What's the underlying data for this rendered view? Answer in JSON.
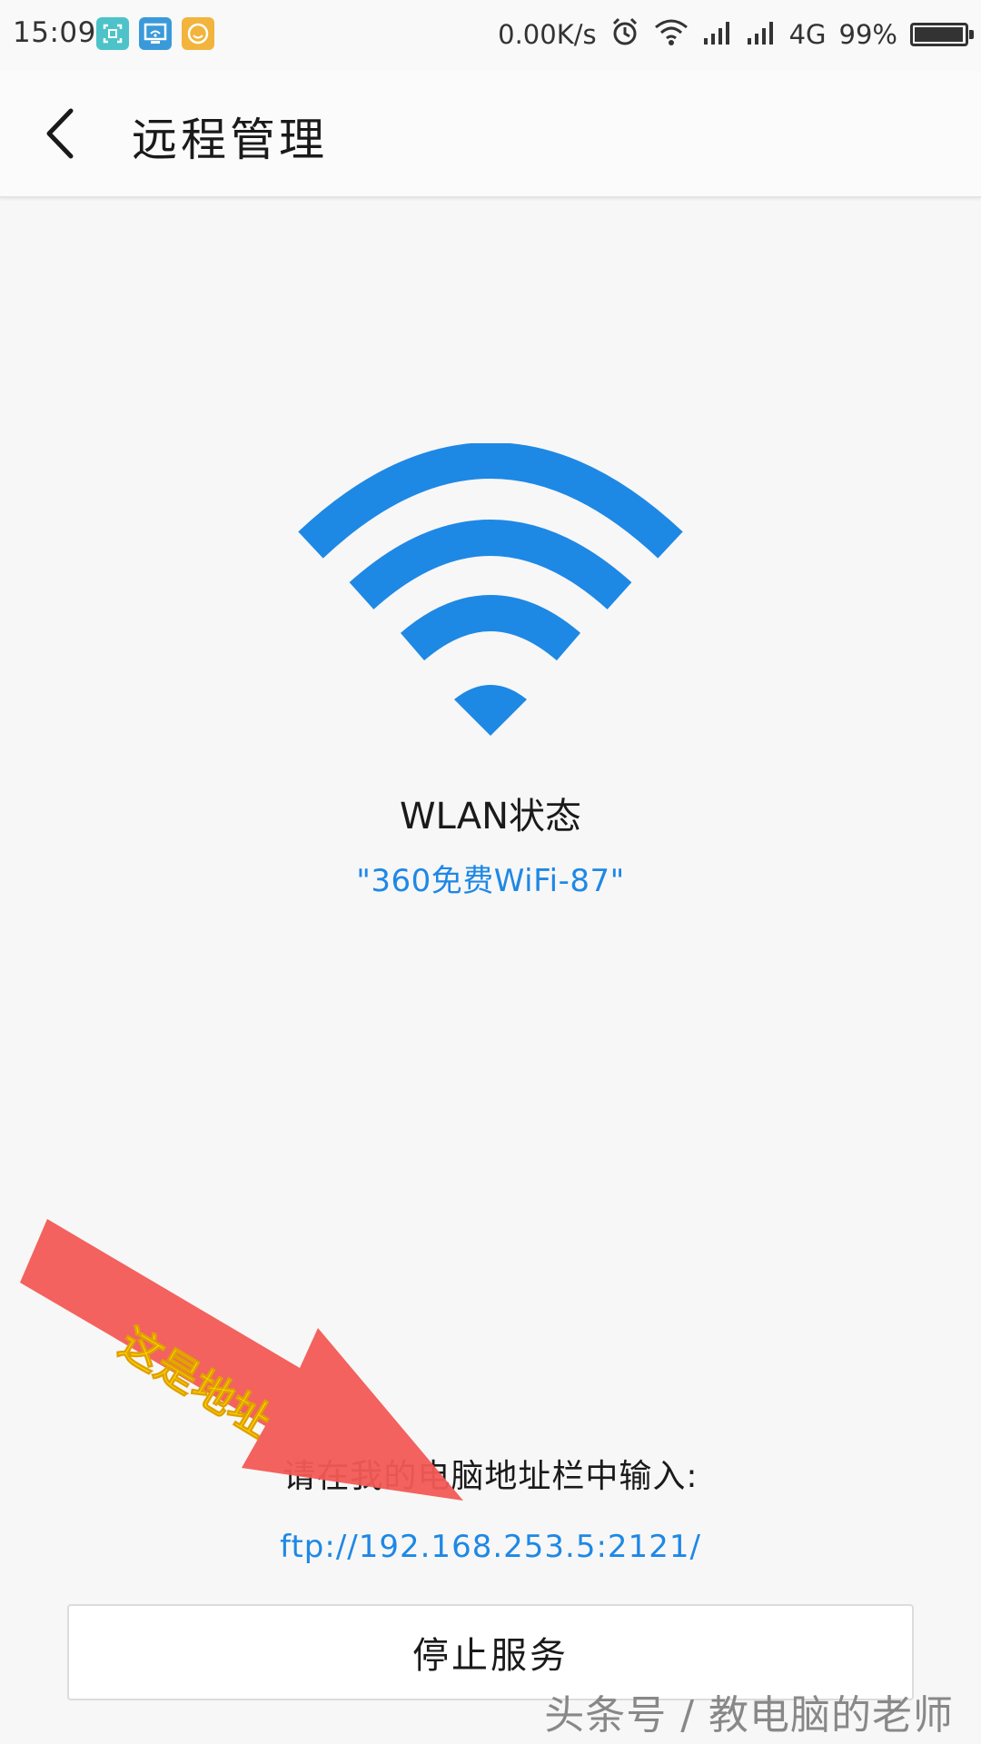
{
  "status_bar": {
    "time": "15:09",
    "net_speed": "0.00K/s",
    "network_type": "4G",
    "battery_level": "99%",
    "battery_fraction": 0.99,
    "notification_icons": [
      {
        "name": "screenshot-notif-icon",
        "color": "#4dc3c9"
      },
      {
        "name": "wifi-share-notif-icon",
        "color": "#3a9ad9"
      },
      {
        "name": "face-notif-icon",
        "color": "#f2b43c"
      }
    ]
  },
  "app_bar": {
    "title": "远程管理",
    "back_icon": "chevron-left-icon"
  },
  "wlan": {
    "label": "WLAN状态",
    "ssid": "\"360免费WiFi-87\"",
    "icon": "wifi-icon",
    "icon_color": "#1e88e5"
  },
  "instruction": {
    "text": "请在我的电脑地址栏中输入:",
    "ftp_address": "ftp://192.168.253.5:2121/",
    "link_color": "#1e88e5"
  },
  "actions": {
    "stop_service": "停止服务"
  },
  "annotation": {
    "text": "这是地址",
    "arrow_color": "#f25a55",
    "text_color": "#ffe000"
  },
  "watermark": {
    "text": "头条号 / 教电脑的老师"
  }
}
